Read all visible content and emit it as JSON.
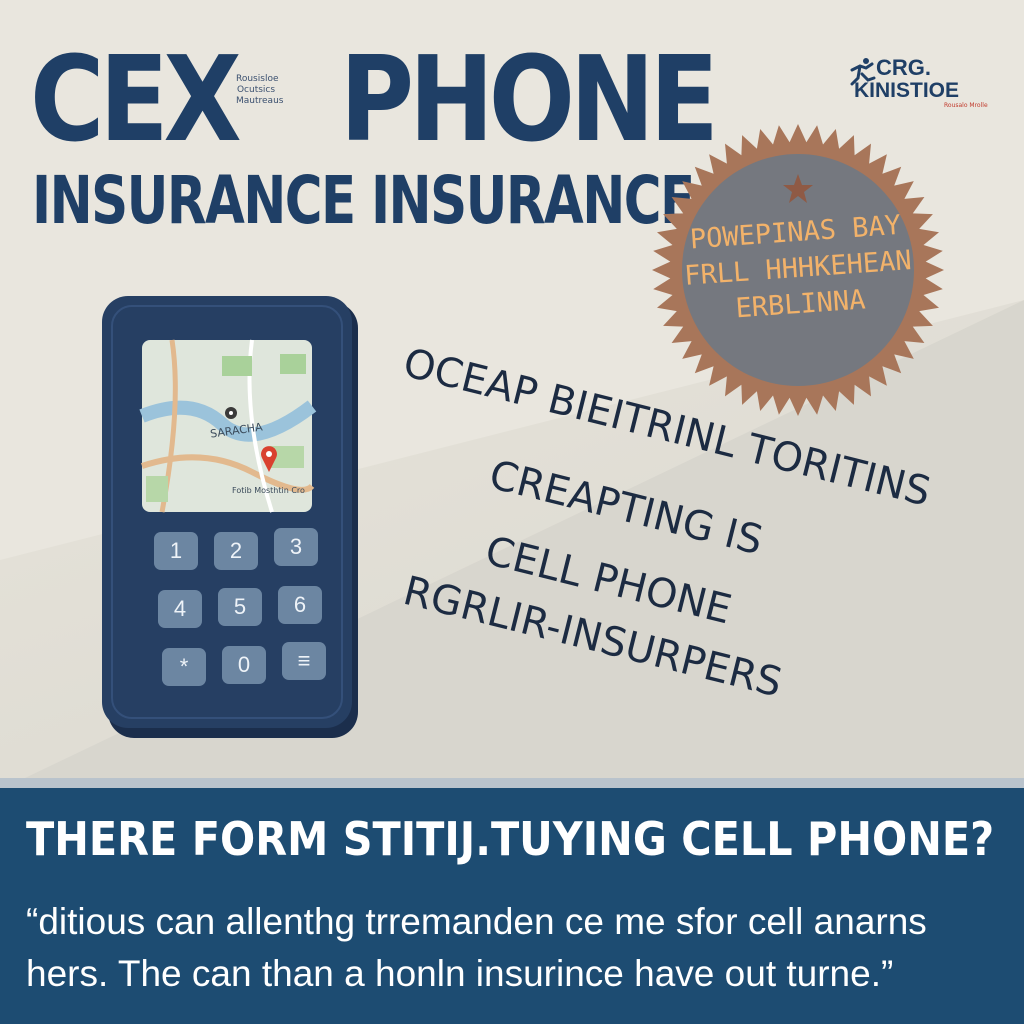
{
  "header": {
    "title_word1": "CEX",
    "title_word2": "PHONE",
    "title_line2": "INSURANCE INSURANCE",
    "tiny_text": "Rousisloe Ocutsics Mautreaus"
  },
  "brand": {
    "line1": "CRG.",
    "line2": "KINISTIOE",
    "tagline": "Rousalo Mrolle",
    "icon": "runner-logo-icon"
  },
  "seal": {
    "lines": [
      "POWEPINAS BAY",
      "FRLL HHHKEHEAN",
      "ERBLINNA"
    ],
    "icon": "star-icon",
    "colors": {
      "body": "#75787f",
      "edge": "#a8765a",
      "text": "#f2b26a"
    }
  },
  "phone": {
    "map_labels": [
      "SARACHA",
      "Fotib Mosthtin Cro"
    ],
    "keys": [
      "1",
      "2",
      "3",
      "4",
      "5",
      "6",
      "*",
      "0",
      "≡"
    ],
    "icons": [
      "map-pin-icon",
      "location-dot-icon"
    ]
  },
  "slanted_text": {
    "line1": "OCEAP BIEITRINL TORITINS",
    "line2": "CREAPTING IS",
    "line3": "CELL PHONE",
    "line4": "RGRLIR-INSURPERS"
  },
  "banner": {
    "question": "THERE FORM STITIJ.TUYING CELL PHONE?",
    "quote": "“ditious can allenthg trremanden ce me sfor cell anarns hers. The can than a honln insurince have out turne.”"
  },
  "colors": {
    "navy": "#1f3f66",
    "banner": "#1d4c72",
    "phone": "#263f63",
    "key": "#6c86a2"
  }
}
